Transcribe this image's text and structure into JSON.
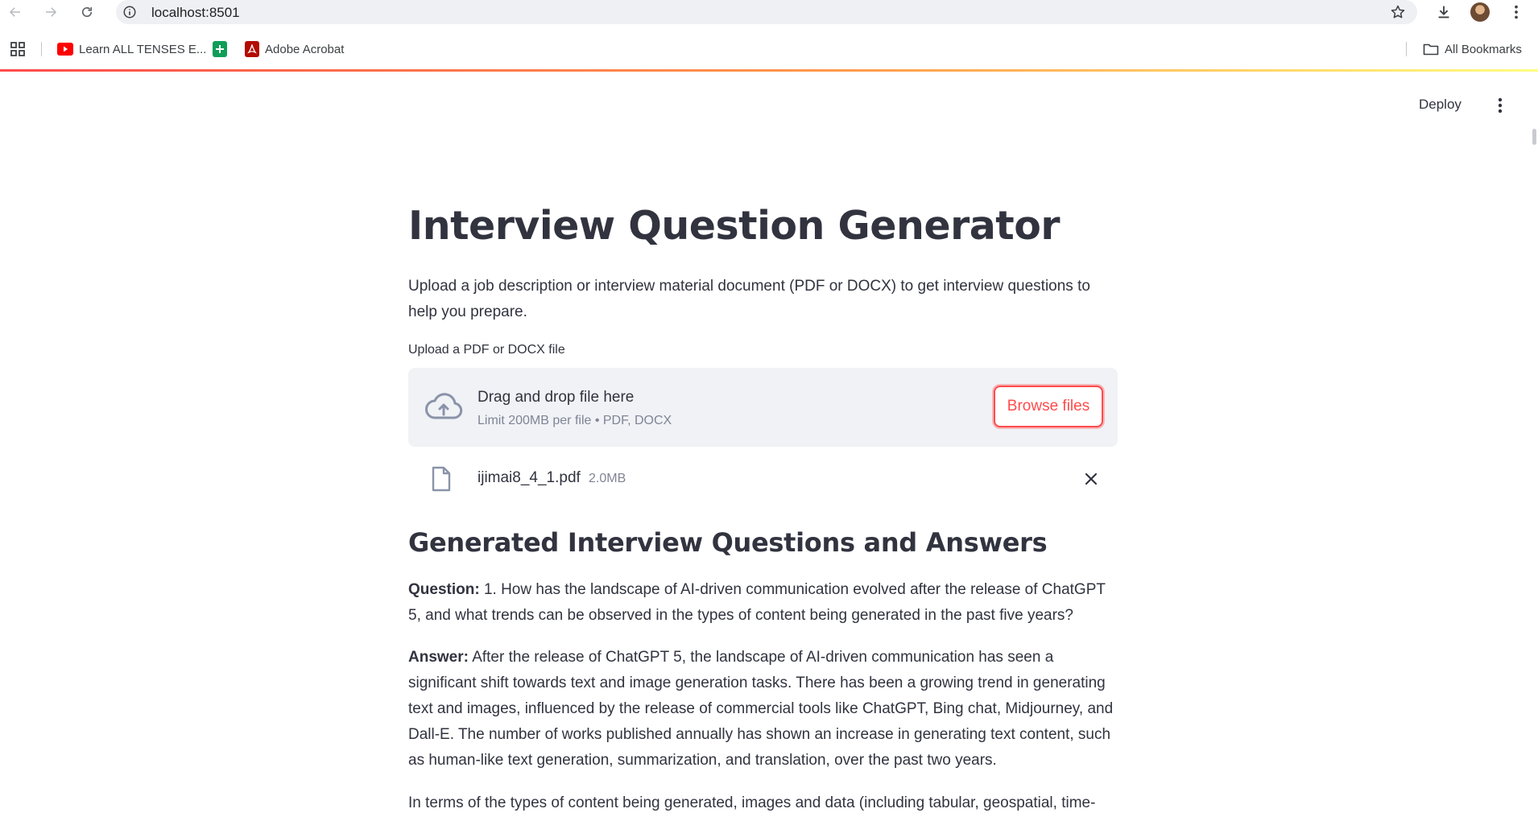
{
  "browser": {
    "url": "localhost:8501",
    "bookmarks": [
      {
        "label": "Learn ALL TENSES E...",
        "icon": "youtube-icon"
      },
      {
        "label": "",
        "icon": "google-sheets-icon"
      },
      {
        "label": "Adobe Acrobat",
        "icon": "adobe-acrobat-icon"
      }
    ],
    "all_bookmarks": "All Bookmarks"
  },
  "header": {
    "deploy_label": "Deploy"
  },
  "main": {
    "title": "Interview Question Generator",
    "subtitle": "Upload a job description or interview material document (PDF or DOCX) to get interview questions to help you prepare.",
    "uploader": {
      "label": "Upload a PDF or DOCX file",
      "drop_text": "Drag and drop file here",
      "limit_text": "Limit 200MB per file • PDF, DOCX",
      "browse_label": "Browse files"
    },
    "file": {
      "name": "ijimai8_4_1.pdf",
      "size": "2.0MB"
    },
    "section_title": "Generated Interview Questions and Answers",
    "question_label": "Question:",
    "question_text": "1. How has the landscape of AI-driven communication evolved after the release of ChatGPT 5, and what trends can be observed in the types of content being generated in the past five years?",
    "answer_label": "Answer:",
    "answer_text": "After the release of ChatGPT 5, the landscape of AI-driven communication has seen a significant shift towards text and image generation tasks. There has been a growing trend in generating text and images, influenced by the release of commercial tools like ChatGPT, Bing chat, Midjourney, and Dall-E. The number of works published annually has shown an increase in generating text content, such as human-like text generation, summarization, and translation, over the past two years.",
    "answer_continued": "In terms of the types of content being generated, images and data (including tabular, geospatial, time-"
  },
  "colors": {
    "accent": "#ff4b4b",
    "text": "#31333f",
    "muted": "#808495",
    "dropzone_bg": "#f0f2f6"
  }
}
